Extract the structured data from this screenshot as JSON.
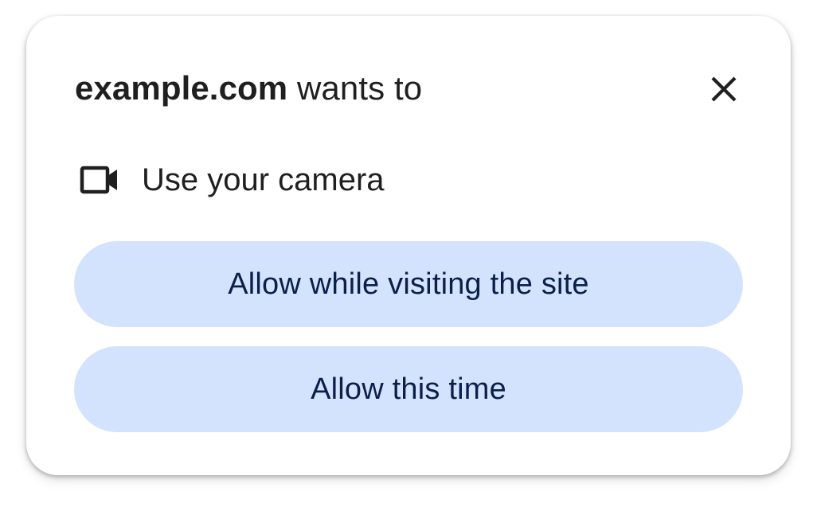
{
  "dialog": {
    "title_origin": "example.com",
    "title_suffix": " wants to",
    "close_icon": "close-icon",
    "permission": {
      "icon": "videocam-icon",
      "label": "Use your camera"
    },
    "buttons": {
      "allow_while_visiting": "Allow while visiting the site",
      "allow_this_time": "Allow this time"
    }
  },
  "colors": {
    "button_bg": "#d3e3fd",
    "button_text": "#0a1f4a",
    "text": "#1f1f1f"
  }
}
